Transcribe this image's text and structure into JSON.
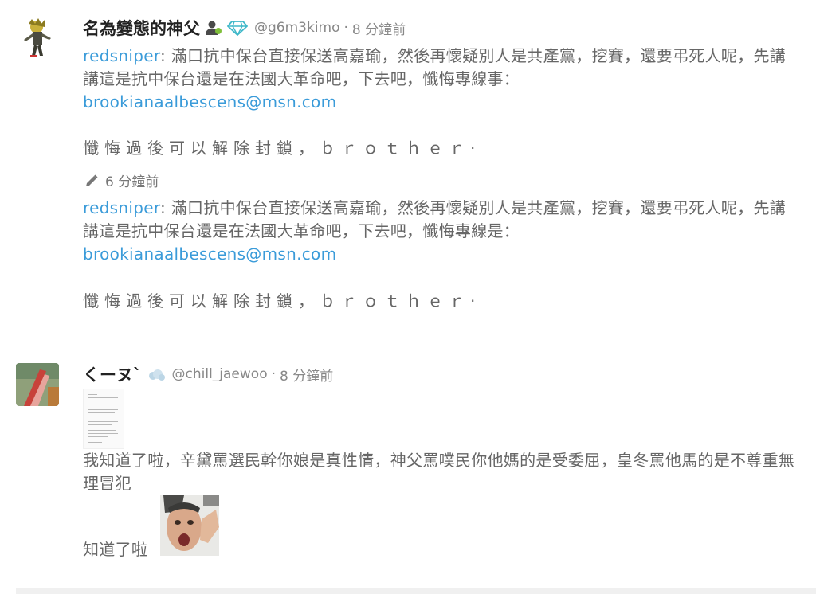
{
  "posts": [
    {
      "author_name": "名為變態的神父",
      "handle": "@g6m3kimo",
      "time": "8 分鐘前",
      "current": {
        "mention": "redsniper",
        "text": ": 滿口抗中保台直接保送高嘉瑜，然後再懷疑別人是共產黨，挖賽，還要弔死人呢，先講講這是抗中保台還是在法國大革命吧，下去吧，懺悔專線事：",
        "email": "brookianaalbescens@msn.com",
        "footer": "懺悔過後可以解除封鎖，ｂｒｏｔｈｅｒ·"
      },
      "edit_time": "6 分鐘前",
      "previous": {
        "mention": "redsniper",
        "text": ": 滿口抗中保台直接保送高嘉瑜，然後再懷疑別人是共產黨，挖賽，還要弔死人呢，先講講這是抗中保台還是在法國大革命吧，下去吧，懺悔專線是：",
        "email": "brookianaalbescens@msn.com",
        "footer": "懺悔過後可以解除封鎖，ｂｒｏｔｈｅｒ·"
      }
    },
    {
      "author_name": "くーヌ`",
      "handle": "@chill_jaewoo",
      "time": "8 分鐘前",
      "text": "我知道了啦，辛黛罵選民幹你娘是真性情，神父罵噗民你他媽的是受委屈，皇冬罵他馬的是不尊重無理冒犯",
      "footer_text": "知道了啦"
    }
  ],
  "separator": "·",
  "icons": [
    "avatar-figure",
    "user-icon",
    "diamond-icon",
    "pencil-icon",
    "cloud-icon",
    "meme-image"
  ],
  "colors": {
    "link": "#3a9bd9",
    "diamond": "#3fb8c9",
    "text": "#666666"
  }
}
